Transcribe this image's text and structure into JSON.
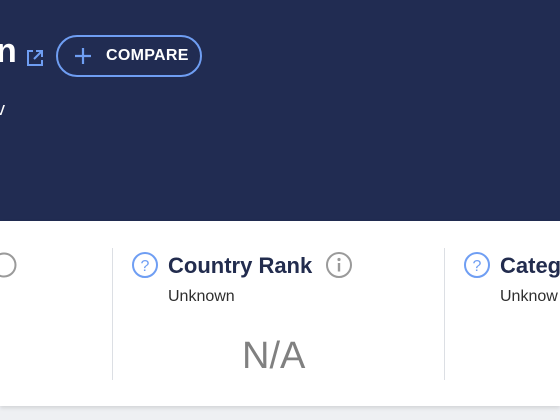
{
  "header": {
    "title_fragment": "n",
    "subtitle_fragment": "v",
    "compare_button": {
      "label": "COMPARE",
      "icon": "plus-icon"
    },
    "external_link_icon": "external-link-icon"
  },
  "cards": [
    {
      "title": "Country Rank",
      "status": "Unknown",
      "value": "N/A"
    },
    {
      "title": "Categ",
      "status": "Unknow"
    }
  ],
  "colors": {
    "header_bg": "#212c52",
    "accent": "#6f9ef3",
    "card_title": "#222c4e",
    "value_gray": "#808080"
  }
}
